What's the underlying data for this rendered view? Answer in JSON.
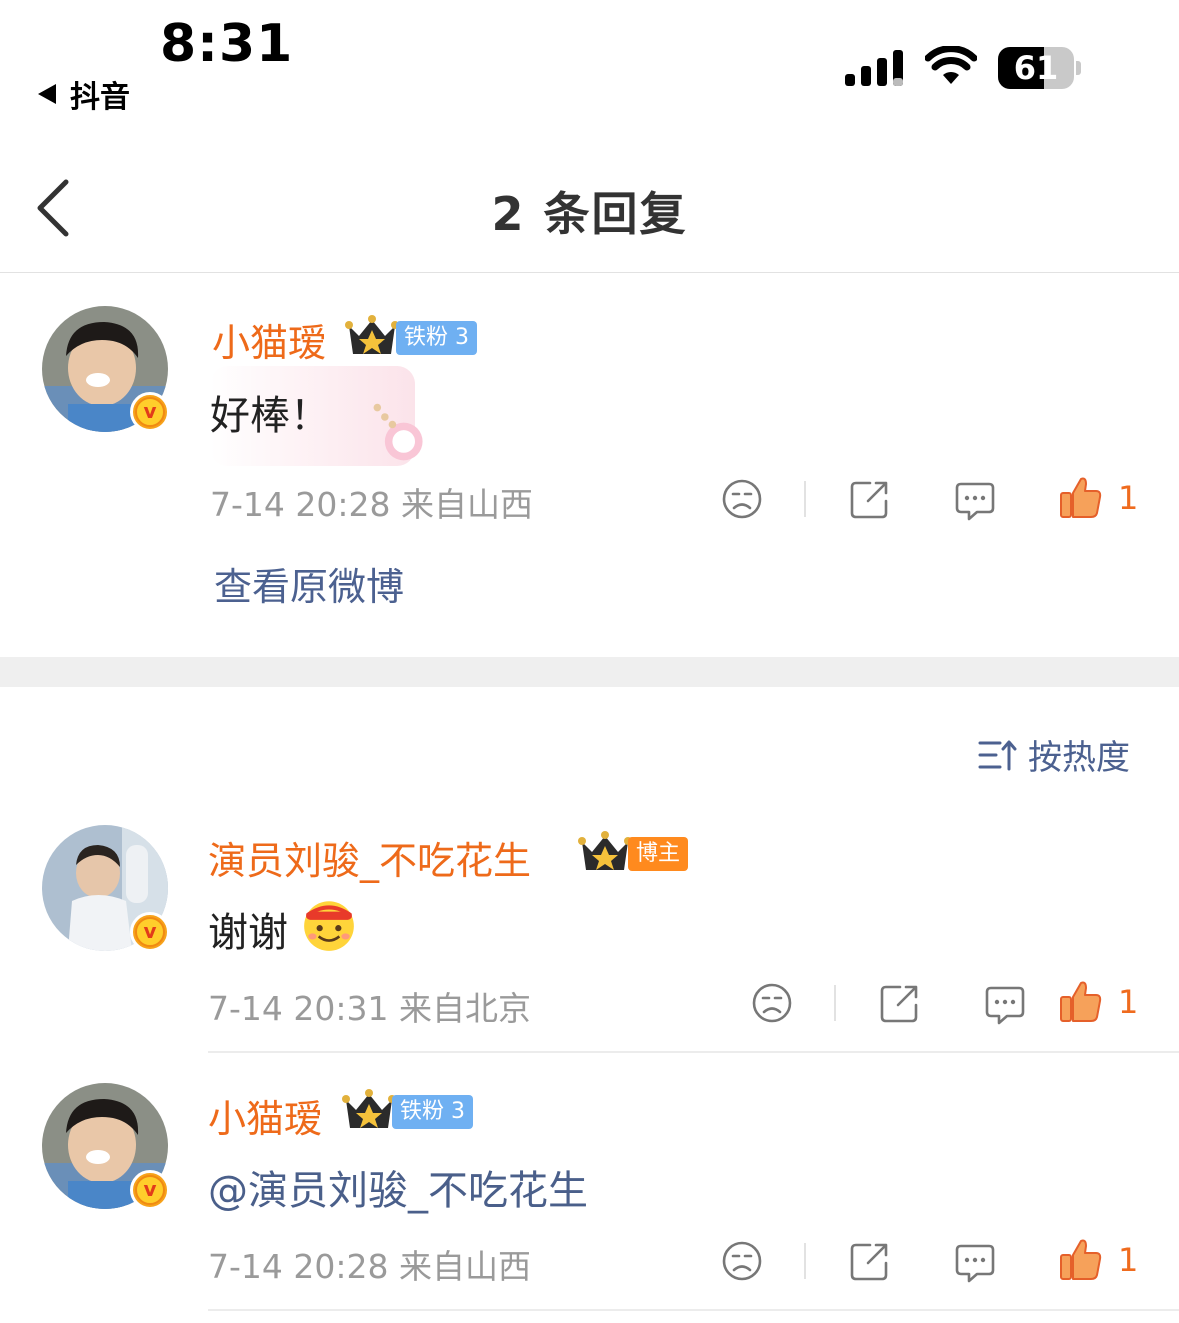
{
  "status_bar": {
    "time": "8:31",
    "back_app": "抖音",
    "battery": "61",
    "battery_level": 0.61
  },
  "nav": {
    "title": "2 条回复"
  },
  "main_comment": {
    "user": "小猫瑷",
    "fan_tag": "铁粉 3",
    "text": "好棒！",
    "time_location": "7-14 20:28 来自山西",
    "likes": "1",
    "view_source": "查看原微博"
  },
  "sort": {
    "label": "按热度"
  },
  "replies": [
    {
      "user": "演员刘骏_不吃花生",
      "tag": "博主",
      "text": "谢谢",
      "time_location": "7-14 20:31 来自北京",
      "likes": "1"
    },
    {
      "user": "小猫瑷",
      "tag": "铁粉 3",
      "text": "@演员刘骏_不吃花生",
      "time_location": "7-14 20:28 来自山西",
      "likes": "1"
    }
  ],
  "colors": {
    "username": "#ee6a1a",
    "link": "#4c6190",
    "like": "#ef6b1e",
    "fan_tag": "#6fb0f2",
    "host_tag": "#ff8a1e"
  }
}
